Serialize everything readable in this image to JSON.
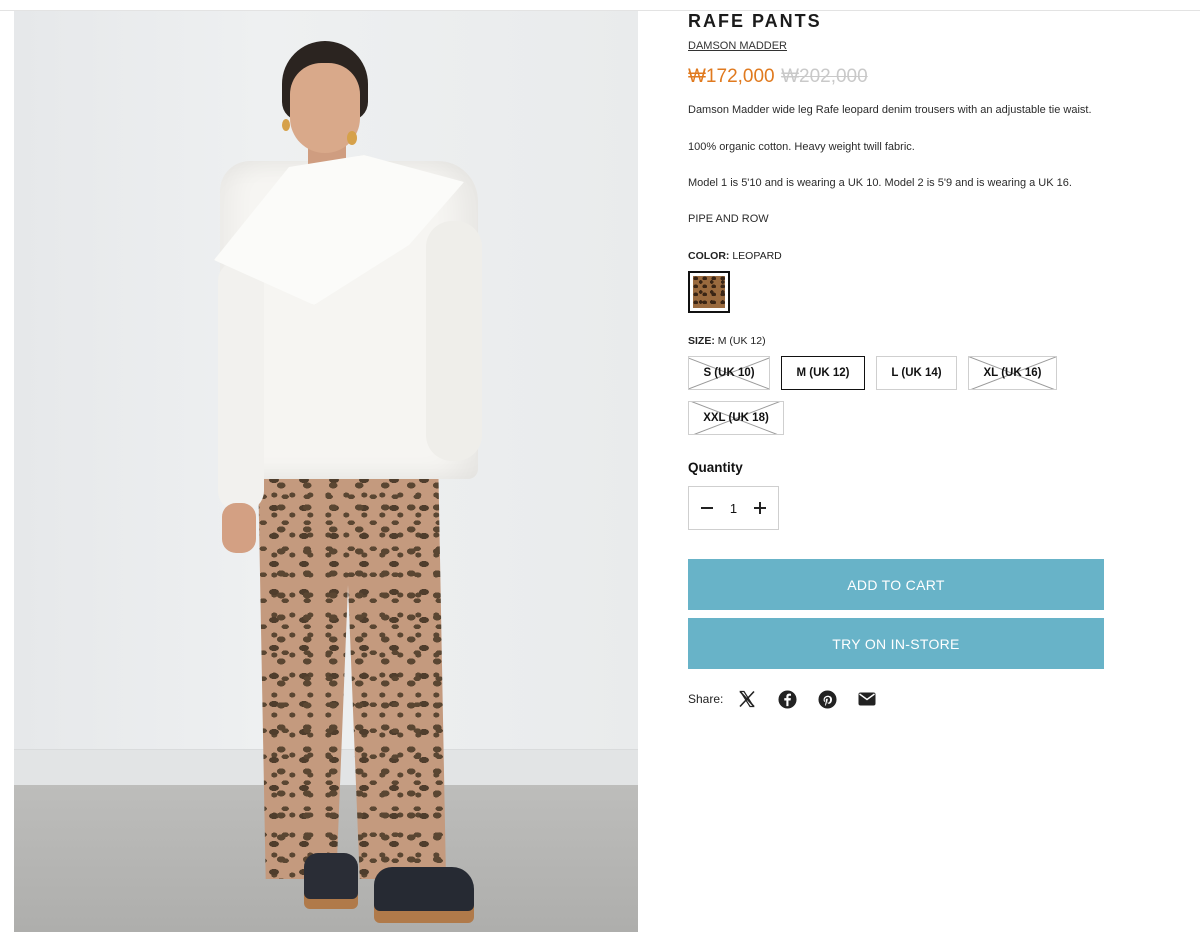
{
  "product": {
    "title": "RAFE PANTS",
    "brand": "DAMSON MADDER",
    "price": "₩172,000",
    "compare_price": "₩202,000",
    "description": [
      "Damson Madder wide leg Rafe leopard denim trousers with an adjustable tie waist.",
      "100% organic cotton. Heavy weight twill fabric.",
      "Model 1 is 5'10 and is wearing a UK 10. Model 2 is 5'9 and is wearing a UK 16.",
      "PIPE AND ROW"
    ]
  },
  "color": {
    "label": "COLOR:",
    "selected": "LEOPARD",
    "swatches": [
      {
        "name": "LEOPARD",
        "selected": true
      }
    ]
  },
  "size": {
    "label": "SIZE:",
    "selected": "M (UK 12)",
    "options": [
      {
        "label": "S (UK 10)",
        "available": false,
        "selected": false
      },
      {
        "label": "M (UK 12)",
        "available": true,
        "selected": true
      },
      {
        "label": "L (UK 14)",
        "available": true,
        "selected": false
      },
      {
        "label": "XL (UK 16)",
        "available": false,
        "selected": false
      },
      {
        "label": "XXL (UK 18)",
        "available": false,
        "selected": false
      }
    ]
  },
  "quantity": {
    "label": "Quantity",
    "value": "1"
  },
  "buttons": {
    "add_to_cart": "ADD TO CART",
    "try_on": "TRY ON IN-STORE"
  },
  "share": {
    "label": "Share:",
    "icons": [
      "x-icon",
      "facebook-icon",
      "pinterest-icon",
      "email-icon"
    ]
  },
  "colors": {
    "accent_button": "#68b3c8",
    "price": "#e07a1f",
    "compare_price": "#c9c9c9"
  }
}
